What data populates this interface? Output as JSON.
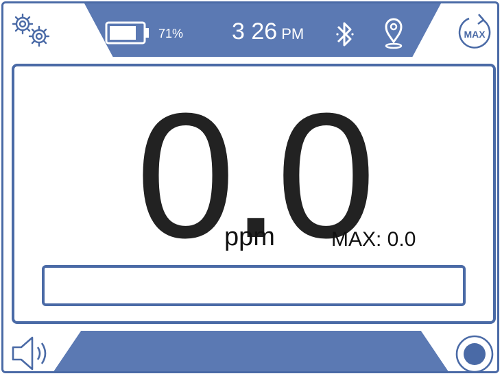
{
  "status": {
    "battery_percent": "71%",
    "time": "3 26",
    "ampm": "PM"
  },
  "reading": {
    "value": "0.0",
    "unit": "ppm",
    "max_label": "MAX: 0.0",
    "level_fraction": 0
  },
  "buttons": {
    "max_label": "MAX"
  },
  "icons": {
    "settings": "gears-icon",
    "battery": "battery-icon",
    "bluetooth": "bluetooth-icon",
    "location": "location-pin-icon",
    "max_reset": "max-reset-icon",
    "speaker": "speaker-icon",
    "record": "record-icon"
  },
  "colors": {
    "accent": "#5b79b3",
    "border": "#4a6aa6",
    "text": "#222222"
  }
}
